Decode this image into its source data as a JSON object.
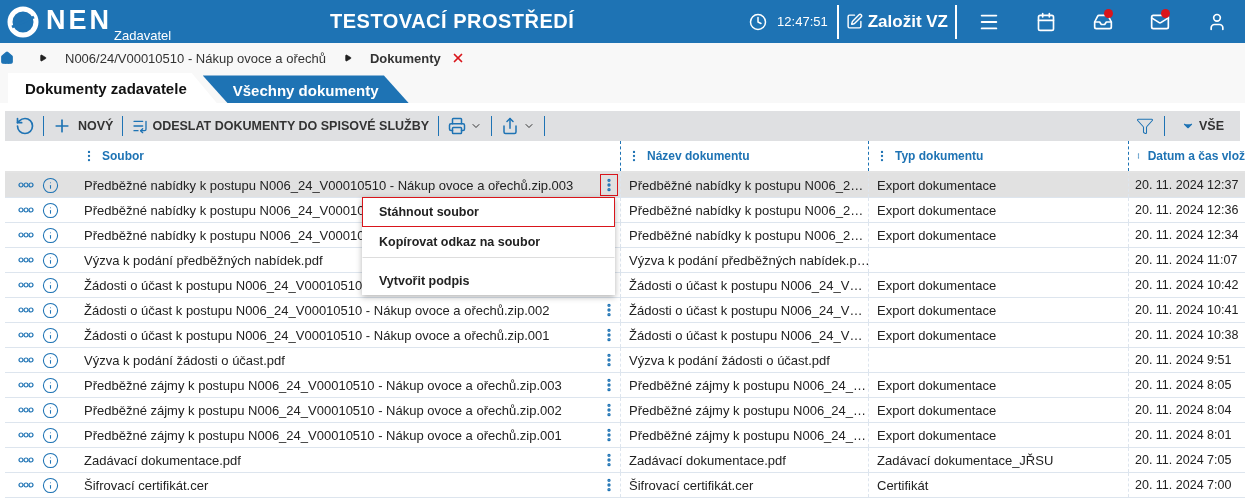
{
  "header": {
    "logo": "NEN",
    "subtitle": "Zadavatel",
    "environment": "TESTOVACÍ PROSTŘEDÍ",
    "time": "12:47:51",
    "create_button": "Založit VZ",
    "icons": [
      {
        "kind": "menu",
        "badge": false
      },
      {
        "kind": "calendar",
        "badge": false
      },
      {
        "kind": "inbox",
        "badge": true
      },
      {
        "kind": "mail",
        "badge": true
      },
      {
        "kind": "user",
        "badge": false
      }
    ]
  },
  "breadcrumb": [
    {
      "label": "N006/24/V00010510 - Nákup ovoce a ořechů",
      "current": false
    },
    {
      "label": "Dokumenty",
      "current": true
    }
  ],
  "tabs": [
    {
      "label": "Dokumenty zadavatele",
      "selected": true
    },
    {
      "label": "Všechny dokumenty",
      "selected": false
    }
  ],
  "toolbar": {
    "new": "NOVÝ",
    "send": "ODESLAT DOKUMENTY DO SPISOVÉ SLUŽBY",
    "filter": "VŠE"
  },
  "columns": [
    "Soubor",
    "Název dokumentu",
    "Typ dokumentu",
    "Datum a čas vlož"
  ],
  "rows": [
    {
      "file": "Předběžné nabídky k postupu N006_24_V00010510 - Nákup ovoce a ořechů.zip.003",
      "name": "Předběžné nabídky k postupu N006_2…",
      "type": "Export dokumentace",
      "date": "20. 11. 2024 12:37",
      "selected": true,
      "menu": [
        {
          "label": "Stáhnout soubor",
          "selected": true,
          "divider_before": false
        },
        {
          "label": "Kopírovat odkaz na soubor",
          "selected": false,
          "divider_before": false
        },
        {
          "label": "Vytvořit podpis",
          "selected": false,
          "divider_before": true
        }
      ]
    },
    {
      "file": "Předběžné nabídky k postupu N006_24_V00010",
      "name": "Předběžné nabídky k postupu N006_2…",
      "type": "Export dokumentace",
      "date": "20. 11. 2024 12:36",
      "selected": false
    },
    {
      "file": "Předběžné nabídky k postupu N006_24_V00010",
      "name": "Předběžné nabídky k postupu N006_2…",
      "type": "Export dokumentace",
      "date": "20. 11. 2024 12:34",
      "selected": false
    },
    {
      "file": "Výzva k podání předběžných nabídek.pdf",
      "name": "Výzva k podání předběžných nabídek.p…",
      "type": "",
      "date": "20. 11. 2024 11:07",
      "selected": false
    },
    {
      "file": "Žádosti o účast k postupu N006_24_V00010510",
      "name": "Žádosti o účast k postupu N006_24_V…",
      "type": "Export dokumentace",
      "date": "20. 11. 2024 10:42",
      "selected": false
    },
    {
      "file": "Žádosti o účast k postupu N006_24_V00010510 - Nákup ovoce a ořechů.zip.002",
      "name": "Žádosti o účast k postupu N006_24_V…",
      "type": "Export dokumentace",
      "date": "20. 11. 2024 10:41",
      "selected": false
    },
    {
      "file": "Žádosti o účast k postupu N006_24_V00010510 - Nákup ovoce a ořechů.zip.001",
      "name": "Žádosti o účast k postupu N006_24_V…",
      "type": "Export dokumentace",
      "date": "20. 11. 2024 10:38",
      "selected": false
    },
    {
      "file": "Výzva k podání žádosti o účast.pdf",
      "name": "Výzva k podání žádosti o účast.pdf",
      "type": "",
      "date": "20. 11. 2024 9:51",
      "selected": false
    },
    {
      "file": "Předběžné zájmy k postupu N006_24_V00010510 - Nákup ovoce a ořechů.zip.003",
      "name": "Předběžné zájmy k postupu N006_24_…",
      "type": "Export dokumentace",
      "date": "20. 11. 2024 8:05",
      "selected": false
    },
    {
      "file": "Předběžné zájmy k postupu N006_24_V00010510 - Nákup ovoce a ořechů.zip.002",
      "name": "Předběžné zájmy k postupu N006_24_…",
      "type": "Export dokumentace",
      "date": "20. 11. 2024 8:04",
      "selected": false
    },
    {
      "file": "Předběžné zájmy k postupu N006_24_V00010510 - Nákup ovoce a ořechů.zip.001",
      "name": "Předběžné zájmy k postupu N006_24_…",
      "type": "Export dokumentace",
      "date": "20. 11. 2024 8:01",
      "selected": false
    },
    {
      "file": "Zadávací dokumentace.pdf",
      "name": "Zadávací dokumentace.pdf",
      "type": "Zadávací dokumentace_JŘSU",
      "date": "20. 11. 2024 7:05",
      "selected": false
    },
    {
      "file": "Šifrovací certifikát.cer",
      "name": "Šifrovací certifikát.cer",
      "type": "Certifikát",
      "date": "20. 11. 2024 7:00",
      "selected": false
    }
  ]
}
